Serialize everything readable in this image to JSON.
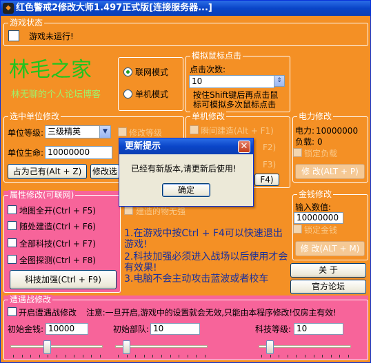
{
  "window": {
    "title": "红色警戒2修改大师1.497正式版[连接服务器...]",
    "icon": "app-icon"
  },
  "game_status": {
    "title": "游戏状态",
    "label": "游戏未运行!"
  },
  "branding": {
    "title": "林毛之家",
    "subtitle": "林无聊的个人论坛博客",
    "title_color": "#22c41e",
    "subtitle_color": "#9ff26b"
  },
  "mode": {
    "online": "联网模式",
    "single": "单机模式",
    "selected": "online"
  },
  "mouse_sim": {
    "title": "模拟鼠标点击",
    "clicks_label": "点击次数:",
    "clicks_value": "10",
    "note": "按住Shift键后再点击鼠标可模拟多次鼠标点击"
  },
  "unit": {
    "title": "选中单位修改",
    "level_label": "单位等级:",
    "level_value": "三级精英",
    "hp_label": "单位生命:",
    "hp_value": "10000000",
    "occupy_button": "占为己有(Alt + Z)",
    "modify_button": "修改选",
    "modify_level": "修改等级"
  },
  "single": {
    "title": "单机修改",
    "fast_build": "瞬间建造(Alt + F1)",
    "f2": "F2)",
    "f3": "F3)",
    "f4_button": "F4)",
    "invincible": "建造的物无强"
  },
  "power": {
    "title": "电力修改",
    "power_label": "电力:",
    "power_value": "10000000",
    "load_label": "负载:",
    "load_value": "0",
    "lock": "锁定负载",
    "button": "修 改(ALT + P)"
  },
  "money": {
    "title": "金钱修改",
    "input_label": "输入数值:",
    "input_value": "10000000",
    "lock": "锁定金钱",
    "button": "修 改(ALT + M)"
  },
  "attr": {
    "title": "属性修改(可联网)",
    "items": [
      "地图全开(Ctrl + F5)",
      "随处建造(Ctrl + F6)",
      "全部科技(Ctrl + F7)",
      "全图探测(Ctrl + F8)"
    ],
    "tech_button": "科技加强(Ctrl + F9)"
  },
  "tips": {
    "lines": [
      "1.在游戏中按Ctrl + F4可以快速退出游戏!",
      "2.科技加强必须进入战场以后使用才会有效果!",
      "3.电脑不会主动攻击蓝波或者校车"
    ],
    "color": "#1a2f9c"
  },
  "about_button": "关 于",
  "forum_button": "官方论坛",
  "encounter": {
    "title": "遭遇战修改",
    "enable": "开启遭遇战修改",
    "note": "注意:一旦开启,游戏中的设置就会无效,只能由本程序修改!仅房主有效!",
    "money_label": "初始金钱:",
    "money_value": "10000",
    "troops_label": "初始部队:",
    "troops_value": "10",
    "tech_label": "科技等级:",
    "tech_value": "10",
    "slider_positions": [
      0.4,
      0.1,
      0.1
    ]
  },
  "dialog": {
    "title": "更新提示",
    "message": "已经有新版本,请更新后使用!",
    "ok": "确定"
  }
}
